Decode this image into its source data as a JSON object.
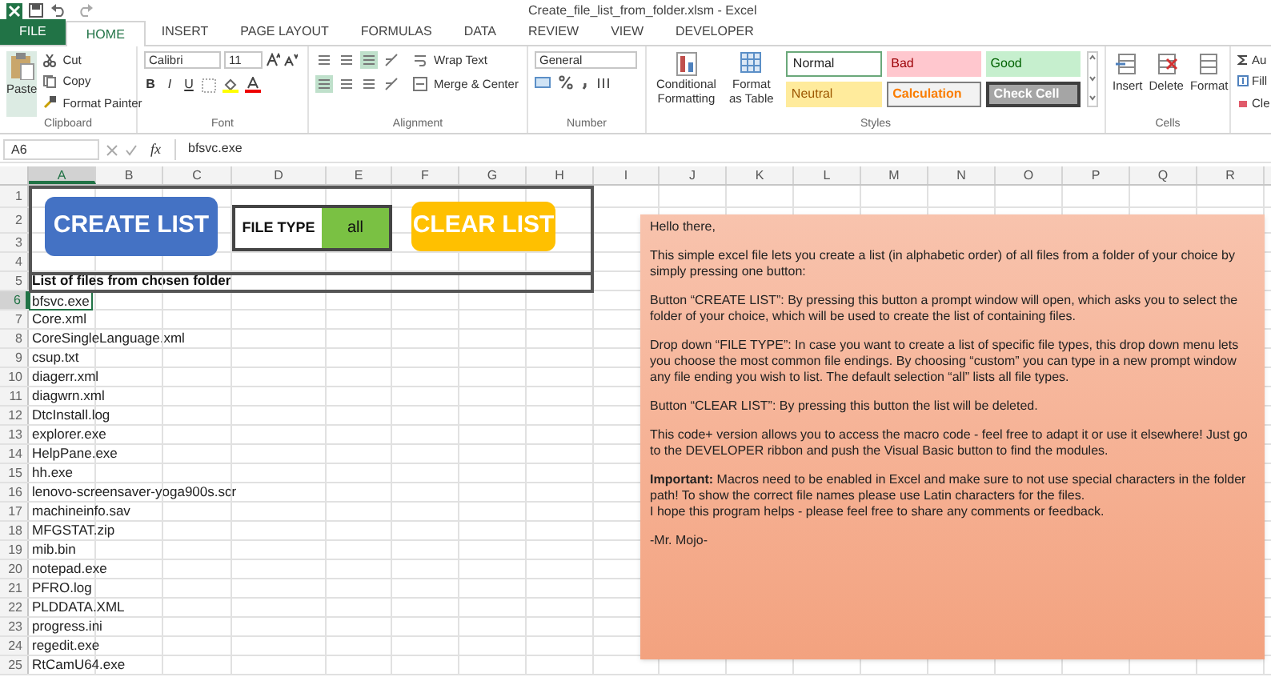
{
  "window": {
    "title": "Create_file_list_from_folder.xlsm - Excel"
  },
  "tabs": [
    {
      "label": "FILE",
      "kind": "file",
      "selected": false
    },
    {
      "label": "HOME",
      "kind": "tab",
      "selected": true
    },
    {
      "label": "INSERT",
      "kind": "tab",
      "selected": false
    },
    {
      "label": "PAGE LAYOUT",
      "kind": "tab",
      "selected": false
    },
    {
      "label": "FORMULAS",
      "kind": "tab",
      "selected": false
    },
    {
      "label": "DATA",
      "kind": "tab",
      "selected": false
    },
    {
      "label": "REVIEW",
      "kind": "tab",
      "selected": false
    },
    {
      "label": "VIEW",
      "kind": "tab",
      "selected": false
    },
    {
      "label": "DEVELOPER",
      "kind": "tab",
      "selected": false
    }
  ],
  "ribbon": {
    "clipboard": {
      "label": "Clipboard",
      "paste": "Paste",
      "cut": "Cut",
      "copy": "Copy",
      "format_painter": "Format Painter"
    },
    "font": {
      "label": "Font",
      "font_name": "Calibri",
      "font_size": "11",
      "buttons": [
        "B",
        "I",
        "U"
      ]
    },
    "alignment": {
      "label": "Alignment",
      "wrap_text": "Wrap Text",
      "merge_center": "Merge & Center"
    },
    "number": {
      "label": "Number",
      "format": "General"
    },
    "styles": {
      "label": "Styles",
      "conditional_formatting": "Conditional Formatting",
      "format_as_table": "Format as Table",
      "cell_styles": [
        {
          "name": "Normal",
          "kind": "normal",
          "color": "#ffffff"
        },
        {
          "name": "Bad",
          "kind": "bad",
          "color": "#ffc7ce"
        },
        {
          "name": "Good",
          "kind": "good",
          "color": "#c6efce"
        },
        {
          "name": "Neutral",
          "kind": "neutral",
          "color": "#ffeb9c"
        },
        {
          "name": "Calculation",
          "kind": "calculation",
          "color": "#f2f2f2"
        },
        {
          "name": "Check Cell",
          "kind": "check",
          "color": "#a5a5a5"
        }
      ]
    },
    "cells": {
      "label": "Cells",
      "buttons": [
        "Insert",
        "Delete",
        "Format"
      ]
    },
    "editing": {
      "items": [
        "Au",
        "Fill",
        "Cle"
      ]
    }
  },
  "formula_bar": {
    "name_box": "A6",
    "fx": "fx",
    "value": "bfsvc.exe"
  },
  "sheet": {
    "columns": [
      {
        "label": "A",
        "selected": true
      },
      {
        "label": "B",
        "selected": false
      },
      {
        "label": "C",
        "selected": false
      },
      {
        "label": "D",
        "selected": false
      },
      {
        "label": "E",
        "selected": false
      },
      {
        "label": "F",
        "selected": false
      },
      {
        "label": "G",
        "selected": false
      },
      {
        "label": "H",
        "selected": false
      },
      {
        "label": "I",
        "selected": false
      },
      {
        "label": "J",
        "selected": false
      },
      {
        "label": "K",
        "selected": false
      },
      {
        "label": "L",
        "selected": false
      },
      {
        "label": "M",
        "selected": false
      },
      {
        "label": "N",
        "selected": false
      },
      {
        "label": "O",
        "selected": false
      },
      {
        "label": "P",
        "selected": false
      },
      {
        "label": "Q",
        "selected": false
      },
      {
        "label": "R",
        "selected": false
      }
    ],
    "rows": [
      {
        "number": "1",
        "selected": false
      },
      {
        "number": "2",
        "selected": false
      },
      {
        "number": "3",
        "selected": false
      },
      {
        "number": "4",
        "selected": false
      },
      {
        "number": "5",
        "selected": false
      },
      {
        "number": "6",
        "selected": true
      },
      {
        "number": "7",
        "selected": false
      },
      {
        "number": "8",
        "selected": false
      },
      {
        "number": "9",
        "selected": false
      },
      {
        "number": "10",
        "selected": false
      },
      {
        "number": "11",
        "selected": false
      },
      {
        "number": "12",
        "selected": false
      },
      {
        "number": "13",
        "selected": false
      },
      {
        "number": "14",
        "selected": false
      },
      {
        "number": "15",
        "selected": false
      },
      {
        "number": "16",
        "selected": false
      },
      {
        "number": "17",
        "selected": false
      },
      {
        "number": "18",
        "selected": false
      },
      {
        "number": "19",
        "selected": false
      },
      {
        "number": "20",
        "selected": false
      },
      {
        "number": "21",
        "selected": false
      },
      {
        "number": "22",
        "selected": false
      },
      {
        "number": "23",
        "selected": false
      },
      {
        "number": "24",
        "selected": false
      },
      {
        "number": "25",
        "selected": false
      }
    ],
    "create_button": "CREATE LIST",
    "file_type": {
      "label": "FILE TYPE",
      "value": "all"
    },
    "clear_button": "CLEAR LIST",
    "list_heading": "List of files from chosen folder",
    "files": [
      "bfsvc.exe",
      "Core.xml",
      "CoreSingleLanguage.xml",
      "csup.txt",
      "diagerr.xml",
      "diagwrn.xml",
      "DtcInstall.log",
      "explorer.exe",
      "HelpPane.exe",
      "hh.exe",
      "lenovo-screensaver-yoga900s.scr",
      "machineinfo.sav",
      "MFGSTAT.zip",
      "mib.bin",
      "notepad.exe",
      "PFRO.log",
      "PLDDATA.XML",
      "progress.ini",
      "regedit.exe",
      "RtCamU64.exe"
    ]
  },
  "note": {
    "paragraphs": [
      "Hello there,",
      "This simple excel file lets you create a list (in alphabetic order) of all files from a folder of your choice by simply pressing one button:",
      "Button “CREATE LIST”: By pressing this button a prompt window will open, which asks you to select the folder of your choice, which will be used to create the list of containing files.",
      "Drop down “FILE TYPE”: In case you want to create a list of specific file types, this drop down menu lets you choose the most common file endings. By choosing “custom” you can type in a new prompt window any file ending you wish to list. The default selection “all” lists all file types.",
      "Button “CLEAR LIST”: By pressing this button the list will be deleted.",
      "This code+ version allows you to access the macro code - feel free to adapt it or use it elsewhere! Just go to the DEVELOPER ribbon and push the Visual Basic button to find the modules.",
      "**Important:** Macros need to be enabled in Excel and make sure to not use special characters in the folder path! To show the correct file names please use Latin characters for the files.\nI hope this program helps - please feel free to share any comments or feedback.",
      "-Mr. Mojo-"
    ]
  }
}
